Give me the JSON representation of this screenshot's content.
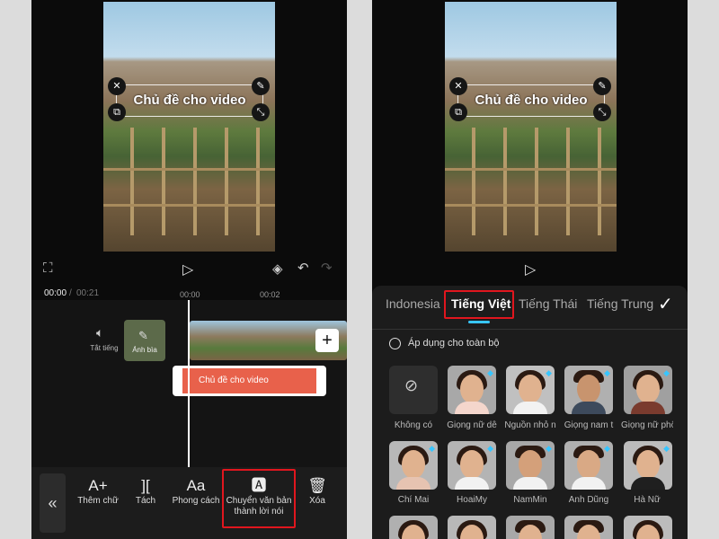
{
  "left": {
    "video_title": "Chủ đề cho video",
    "time_current": "00:00",
    "time_separator": "/",
    "time_total": "00:21",
    "ruler_marks": [
      "00:00",
      "00:02"
    ],
    "mute_label": "Tắt tiếng",
    "cover_label": "Ảnh bìa",
    "text_clip_label": "Chủ đề cho video",
    "toolbar": {
      "add_text": "Thêm chữ",
      "split": "Tách",
      "style": "Phong cách",
      "tts_line1": "Chuyển văn bản",
      "tts_line2": "thành lời nói",
      "delete": "Xóa"
    }
  },
  "right": {
    "video_title": "Chủ đề cho video",
    "tabs": [
      "Indonesia",
      "Tiếng Việt",
      "Tiếng Thái",
      "Tiếng Trung"
    ],
    "apply_all": "Áp dụng cho toàn bộ",
    "voices": [
      "Không có",
      "Giọng nữ dễ",
      "Nguồn nhỏ n",
      "Giọng nam t",
      "Giọng nữ phổ",
      "Chí Mai",
      "HoaiMy",
      "NamMin",
      "Anh Dũng",
      "Hà Nữ"
    ]
  },
  "colors": {
    "highlight": "#e0161e",
    "accent": "#38c6ff",
    "text_clip": "#e8614b"
  }
}
